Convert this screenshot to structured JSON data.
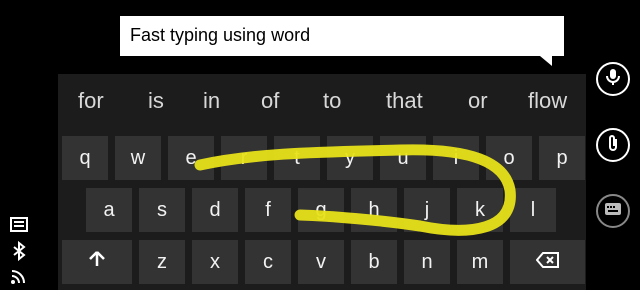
{
  "message": {
    "text": "Fast typing using word"
  },
  "suggestions": [
    "for",
    "is",
    "in",
    "of",
    "to",
    "that",
    "or",
    "flow"
  ],
  "keyboard": {
    "row1": [
      "q",
      "w",
      "e",
      "r",
      "t",
      "y",
      "u",
      "i",
      "o",
      "p"
    ],
    "row2": [
      "a",
      "s",
      "d",
      "f",
      "g",
      "h",
      "j",
      "k",
      "l"
    ],
    "row3": [
      "z",
      "x",
      "c",
      "v",
      "b",
      "n",
      "m"
    ]
  },
  "icons": {
    "shift": "up-arrow-icon",
    "backspace": "backspace-icon",
    "mic": "microphone-icon",
    "attach": "paperclip-icon",
    "emoji": "emoji-keyboard-icon"
  },
  "colors": {
    "swipe_trail": "#e8e21a",
    "key_bg": "#333333",
    "keyboard_bg": "#1c1c1c"
  }
}
